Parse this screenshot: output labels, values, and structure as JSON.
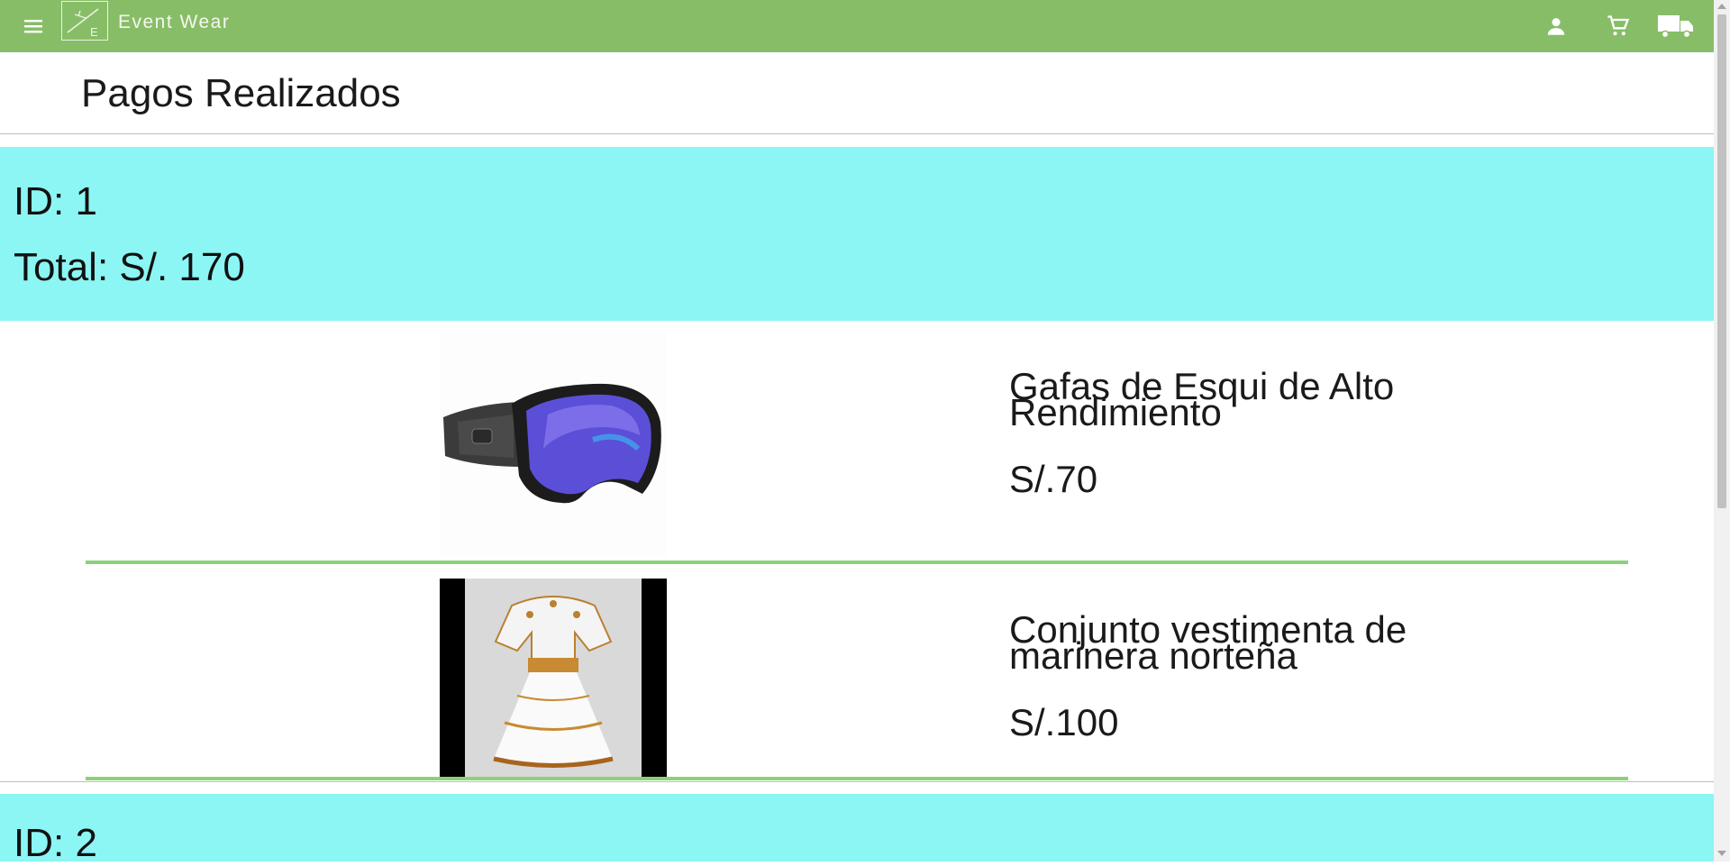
{
  "header": {
    "brand": "Event Wear",
    "icons": [
      "menu-icon",
      "account-icon",
      "cart-icon",
      "truck-icon"
    ],
    "accent": "#88bd68"
  },
  "page": {
    "title": "Pagos Realizados"
  },
  "payments": [
    {
      "id_text": "ID: 1",
      "total_text": "Total: S/. 170",
      "items": [
        {
          "name": "Gafas de Esqui de Alto Rendimiento",
          "price": "S/.70",
          "image": "ski-goggles-image"
        },
        {
          "name": "Conjunto vestimenta de marinera norteña",
          "price": "S/.100",
          "image": "marinera-dress-image"
        }
      ]
    },
    {
      "id_text": "ID: 2"
    }
  ],
  "colors": {
    "payment_header_bg": "#8cf6f4",
    "divider": "#8bd17a"
  }
}
